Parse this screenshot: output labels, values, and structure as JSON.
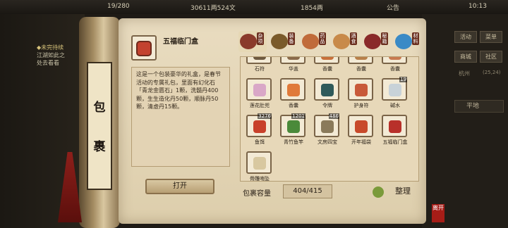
{
  "topbar": {
    "stat1": "19/280",
    "stat2": "30611两524文",
    "stat3": "1854两",
    "notice": "公告",
    "time": "10:13"
  },
  "quest": {
    "header": "◆未完待续",
    "line1": "江湖如此之",
    "line2": "处去看看"
  },
  "right_buttons": [
    "活动",
    "菜单",
    "商城",
    "社区"
  ],
  "right_status": {
    "place": "杭州",
    "coords": "(25,24)",
    "terrain": "平地"
  },
  "bag": {
    "label_1": "包",
    "label_2": "裹"
  },
  "selected": {
    "name": "五福临门盒",
    "description": "这是一个包装豪华的礼盒，是春节活动的专属礼包，里面有幻化石「青龙金匮石」1颗，洗髓丹400颗，生生造化丹50颗，顺脉丹50颗，清虚丹15颗。",
    "action": "打开"
  },
  "tabs": [
    {
      "label": "杂项",
      "color": "#8a3a2a",
      "active": true
    },
    {
      "label": "装备",
      "color": "#7a5a2a",
      "active": false
    },
    {
      "label": "药品",
      "color": "#c06b3a",
      "active": false
    },
    {
      "label": "酒食",
      "color": "#c88a4a",
      "active": false
    },
    {
      "label": "秘籍",
      "color": "#8a2a2a",
      "active": false
    },
    {
      "label": "材料",
      "color": "#3a8ac6",
      "active": false
    }
  ],
  "items_row0": [
    {
      "name": "石符",
      "color": "#6e5a40"
    },
    {
      "name": "华盖",
      "color": "#8a6a4a"
    },
    {
      "name": "香囊",
      "color": "#c8703a"
    },
    {
      "name": "香囊",
      "color": "#b8804a"
    },
    {
      "name": "香囊",
      "color": "#c87a50"
    }
  ],
  "items_row1": [
    {
      "name": "莲花肚兜",
      "color": "#d9a7c7",
      "count": ""
    },
    {
      "name": "香囊",
      "color": "#e07a3a",
      "count": ""
    },
    {
      "name": "令牌",
      "color": "#2f5a5a",
      "count": ""
    },
    {
      "name": "护身符",
      "color": "#c85a3a",
      "count": ""
    },
    {
      "name": "碱水",
      "color": "#c8d2d8",
      "count": "19"
    }
  ],
  "items_row2": [
    {
      "name": "鱼饵",
      "color": "#c8402a",
      "count": "3276"
    },
    {
      "name": "青竹鱼竿",
      "color": "#4a8a3a",
      "count": "1201"
    },
    {
      "name": "文房四宝",
      "color": "#8a7a5a",
      "count": "486"
    },
    {
      "name": "开年福袋",
      "color": "#c84a2a",
      "count": ""
    },
    {
      "name": "五福临门盒",
      "color": "#b8302a",
      "count": ""
    }
  ],
  "items_row3": [
    {
      "name": "骨雕哨坠",
      "color": "#d8c8a0",
      "count": ""
    }
  ],
  "capacity": {
    "label": "包裹容量",
    "value": "404/415"
  },
  "sort_label": "整理",
  "seal": "离开"
}
